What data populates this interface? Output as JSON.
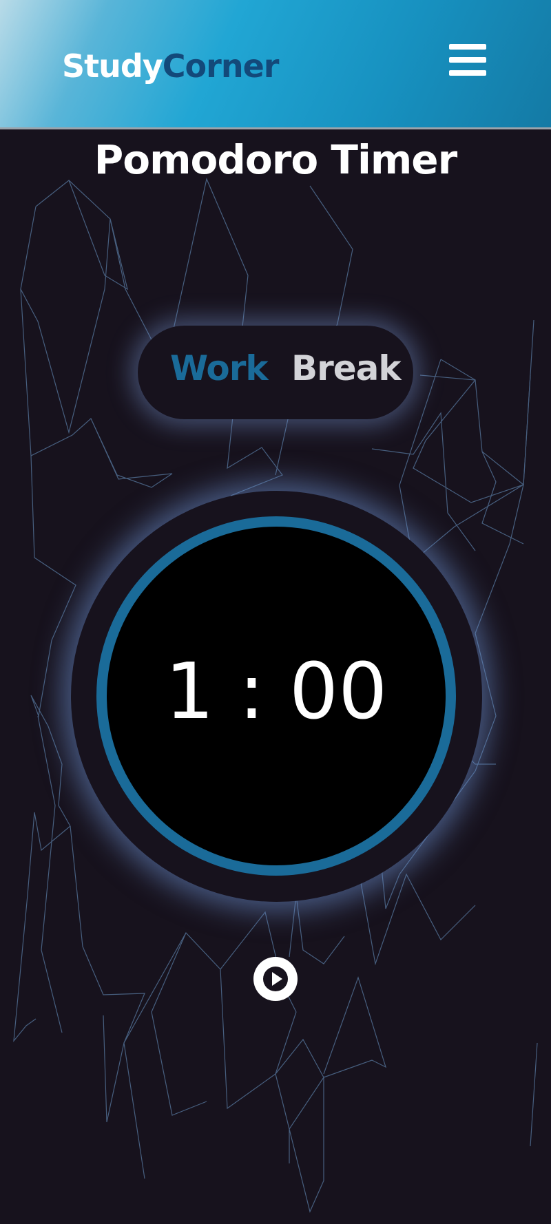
{
  "header": {
    "brand_part1": "Study",
    "brand_part2": "Corner",
    "menu_icon": "hamburger-menu-icon"
  },
  "main": {
    "title": "Pomodoro Timer",
    "modes": {
      "work": "Work",
      "break": "Break",
      "active": "Work"
    },
    "timer": {
      "display": "1 : 00"
    },
    "controls": {
      "play_icon": "play-icon"
    }
  },
  "colors": {
    "accent": "#1a6b99",
    "background": "#17121d",
    "brand_dark": "#13497a",
    "header_gradient_start": "#b9dbe8",
    "header_gradient_end": "#147aa5",
    "inactive_mode": "#d3d3d8"
  }
}
